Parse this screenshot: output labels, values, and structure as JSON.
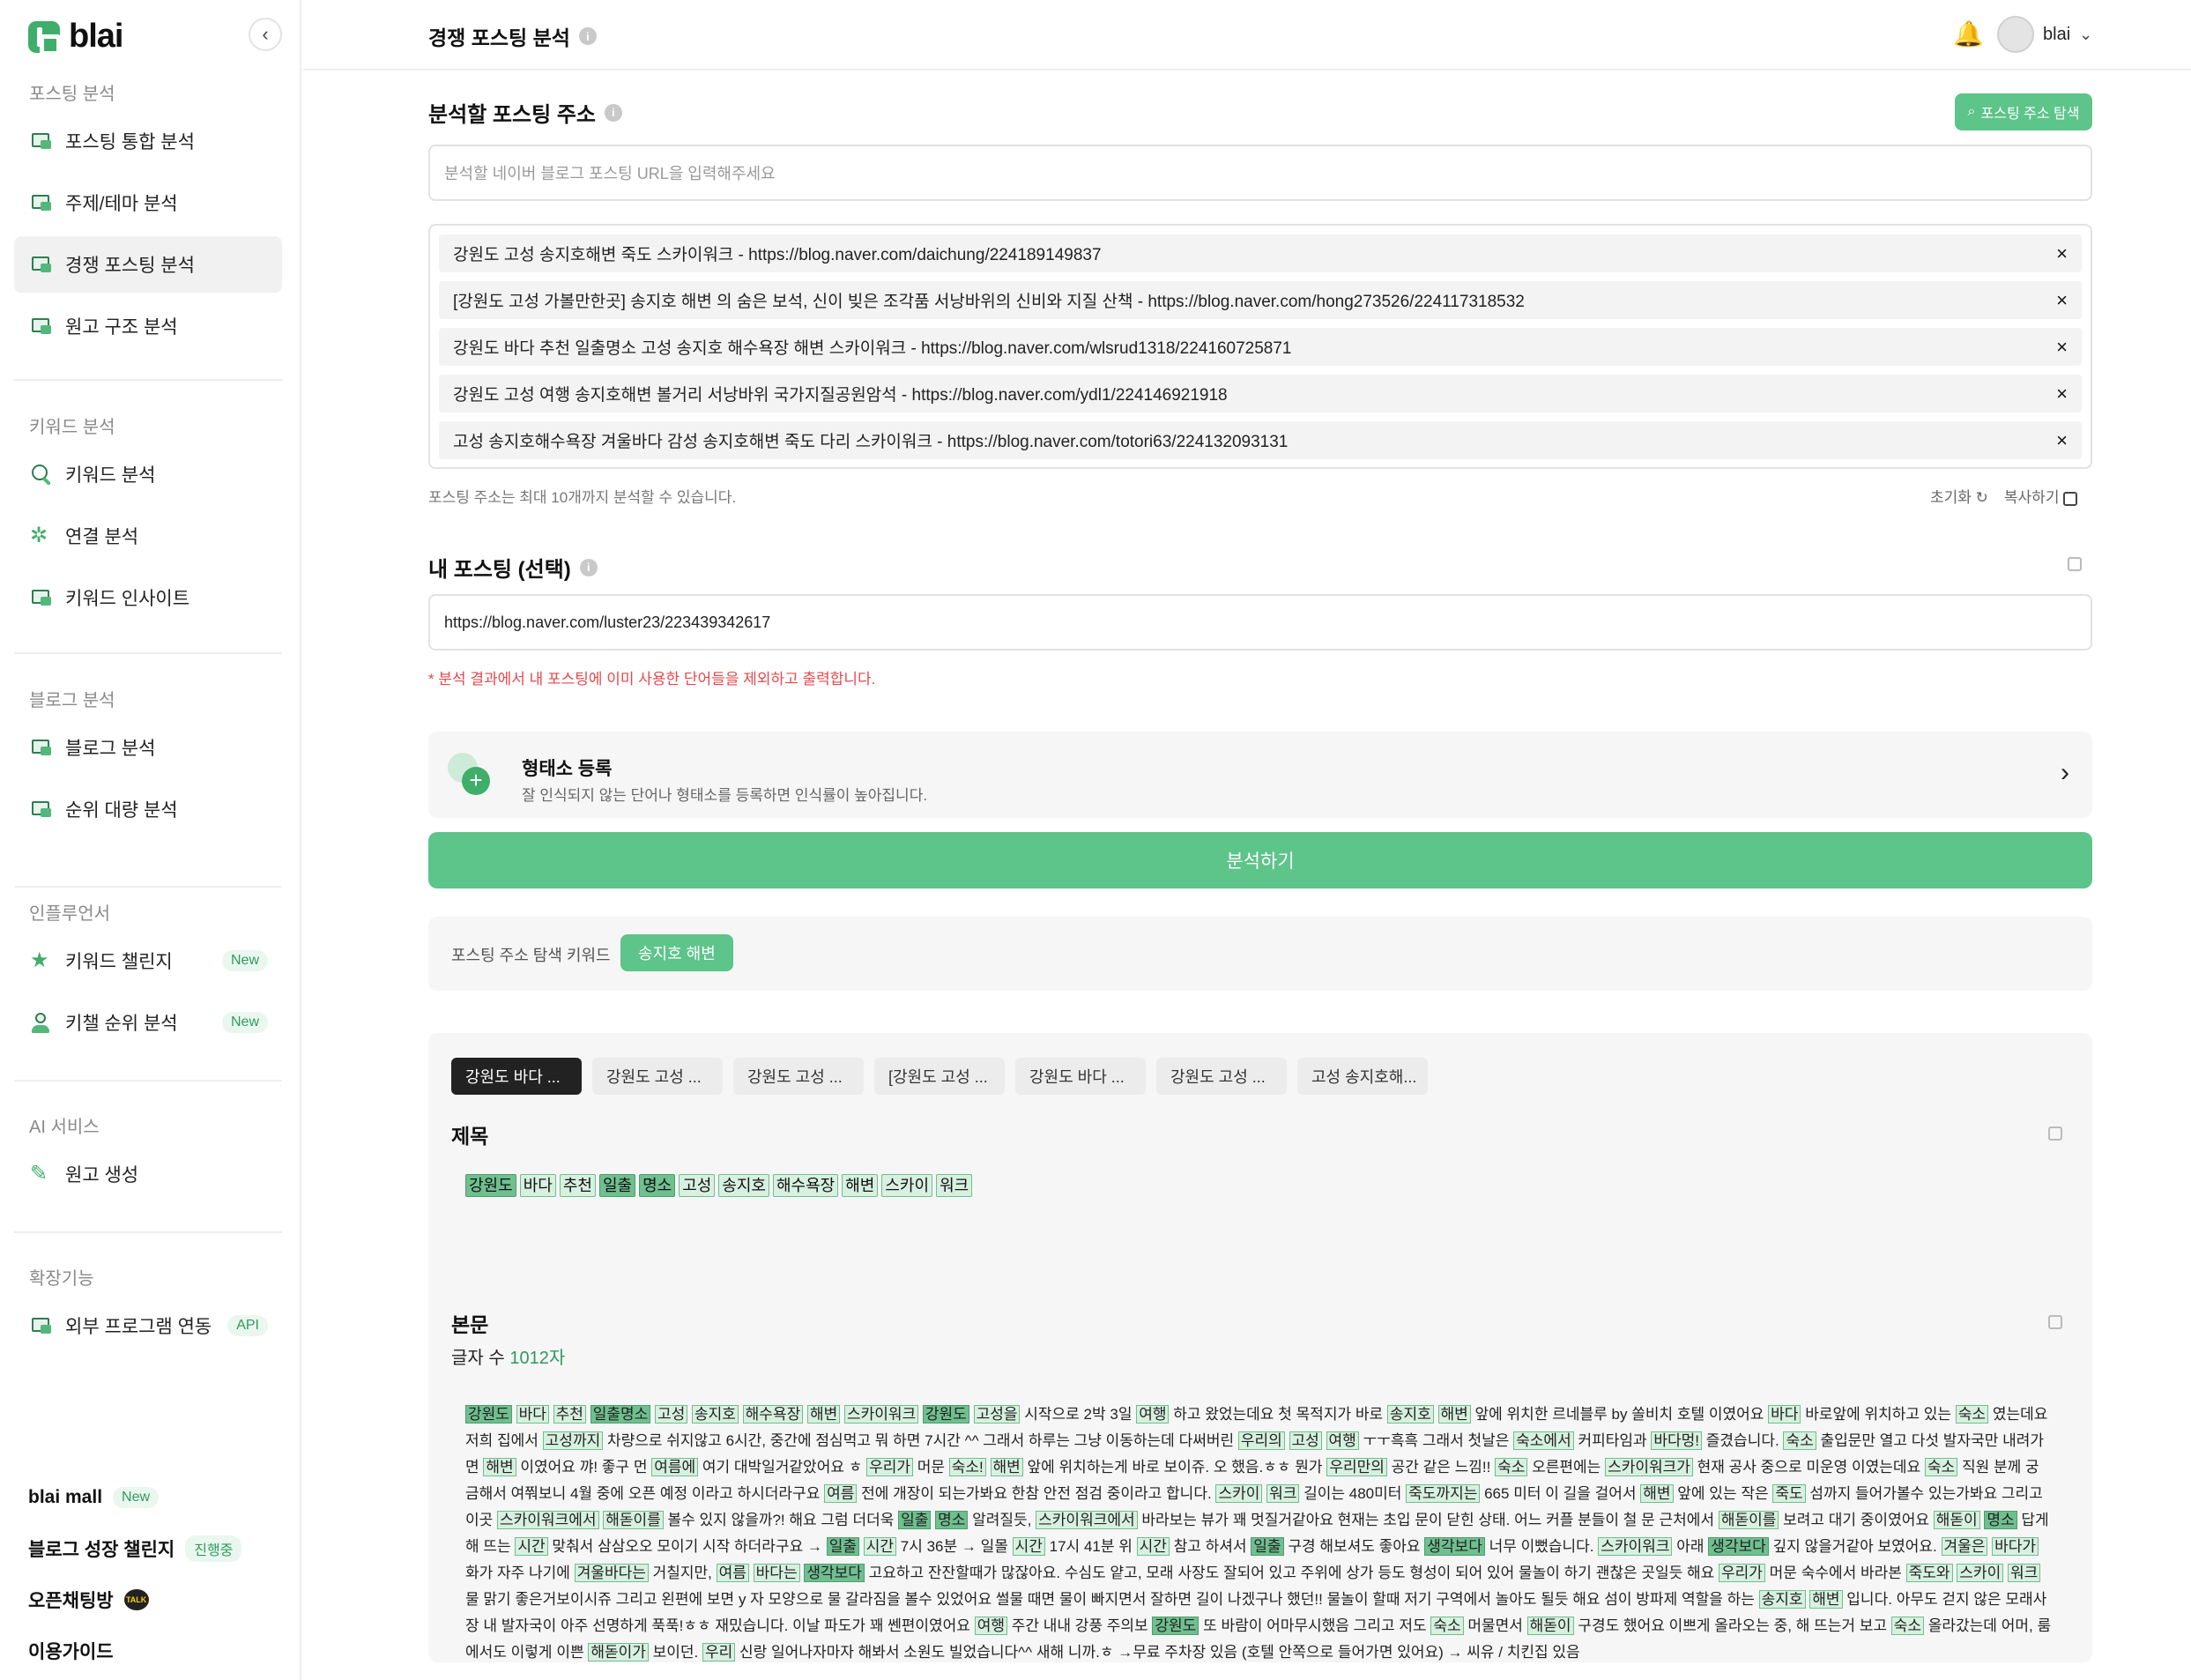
{
  "brand": {
    "name": "blai"
  },
  "sidebar": {
    "sections": [
      {
        "heading": "포스팅 분석",
        "items": [
          {
            "label": "포스팅 통합 분석"
          },
          {
            "label": "주제/테마 분석"
          },
          {
            "label": "경쟁 포스팅 분석"
          },
          {
            "label": "원고 구조 분석"
          }
        ]
      },
      {
        "heading": "키워드 분석",
        "items": [
          {
            "label": "키워드 분석"
          },
          {
            "label": "연결 분석"
          },
          {
            "label": "키워드 인사이트"
          }
        ]
      },
      {
        "heading": "블로그 분석",
        "items": [
          {
            "label": "블로그 분석"
          },
          {
            "label": "순위 대량 분석"
          }
        ]
      },
      {
        "heading": "인플루언서",
        "items": [
          {
            "label": "키워드 챌린지",
            "badge": "New"
          },
          {
            "label": "키챌 순위 분석",
            "badge": "New"
          }
        ]
      },
      {
        "heading": "AI 서비스",
        "items": [
          {
            "label": "원고 생성"
          }
        ]
      },
      {
        "heading": "확장기능",
        "items": [
          {
            "label": "외부 프로그램 연동",
            "badge": "API"
          }
        ]
      }
    ],
    "bottom": [
      {
        "label": "blai mall",
        "tag": "New"
      },
      {
        "label": "블로그 성장 챌린지",
        "tag": "진행중"
      },
      {
        "label": "오픈채팅방",
        "icon_text": "TALK"
      },
      {
        "label": "이용가이드"
      }
    ]
  },
  "header": {
    "title": "경쟁 포스팅 분석",
    "user": "blai"
  },
  "posting": {
    "title": "분석할 포스팅 주소",
    "explore_button": "포스팅 주소 탐색",
    "placeholder": "분석할 네이버 블로그 포스팅 URL을 입력해주세요",
    "urls": [
      "강원도 고성 송지호해변 죽도 스카이워크 - https://blog.naver.com/daichung/224189149837",
      "[강원도 고성 가볼만한곳] 송지호 해변 의 숨은 보석, 신이 빚은 조각품 서낭바위의 신비와 지질 산책 - https://blog.naver.com/hong273526/224117318532",
      "강원도 바다 추천 일출명소 고성 송지호 해수욕장 해변 스카이워크 - https://blog.naver.com/wlsrud1318/224160725871",
      "강원도 고성 여행 송지호해변 볼거리 서낭바위 국가지질공원암석 - https://blog.naver.com/ydl1/224146921918",
      "고성 송지호해수욕장 겨울바다 감성 송지호해변 죽도 다리 스카이워크 - https://blog.naver.com/totori63/224132093131"
    ],
    "limit_note": "포스팅 주소는 최대 10개까지 분석할 수 있습니다.",
    "reset": "초기화",
    "copy": "복사하기"
  },
  "my_posting": {
    "title": "내 포스팅 (선택)",
    "value": "https://blog.naver.com/luster23/223439342617",
    "warning": "* 분석 결과에서 내 포스팅에 이미 사용한 단어들을 제외하고 출력합니다."
  },
  "morph": {
    "icon_text": "가",
    "title": "형태소 등록",
    "subtitle": "잘 인식되지 않는 단어나 형태소를 등록하면 인식률이 높아집니다."
  },
  "analyze_button": "분석하기",
  "keyword_bar": {
    "label": "포스팅 주소 탐색 키워드",
    "chip": "송지호 해변"
  },
  "result": {
    "tabs": [
      "강원도 바다 ...",
      "강원도 고성 ...",
      "강원도 고성 ...",
      "[강원도 고성 ...",
      "강원도 바다 ...",
      "강원도 고성 ...",
      "고성 송지호해..."
    ],
    "title_heading": "제목",
    "title_tokens": [
      {
        "t": "강원도",
        "d": true
      },
      {
        "t": "바다"
      },
      {
        "t": "추천"
      },
      {
        "t": "일출",
        "d": true
      },
      {
        "t": "명소",
        "d": true
      },
      {
        "t": "고성"
      },
      {
        "t": "송지호"
      },
      {
        "t": "해수욕장"
      },
      {
        "t": "해변"
      },
      {
        "t": "스카이"
      },
      {
        "t": "워크"
      }
    ],
    "body_heading": "본문",
    "count_label": "글자 수",
    "count_value": "1012자",
    "body": "강원도 바다 추천 일출명소 고성 송지호 해수욕장 해변 스카이워크 강원도 고성을 시작으로 2박 3일 여행 하고 왔었는데요 첫 목적지가 바로 송지호 해변 앞에 위치한 르네블루 by 쏠비치 호텔 이였어요 바다 바로앞에 위치하고 있는 숙소 였는데요 저희 집에서 고성까지 차량으로 쉬지않고 6시간, 중간에 점심먹고 뭐 하면 7시간 ^^ 그래서 하루는 그냥 이동하는데 다써버린 우리의 고성 여행 ㅜㅜ흑흑 그래서 첫날은 숙소에서 커피타임과 바다멍! 즐겼습니다. 숙소 출입문만 열고 다섯 발자국만 내려가면 해변 이였어요 꺄! 좋구 먼 여름에 여기 대박일거같았어요 ㅎ 우리가 머문 숙소! 해변 앞에 위치하는게 바로 보이쥬. 오 했음.ㅎㅎ 뭔가 우리만의 공간 같은 느낌!! 숙소 오른편에는 스카이워크가 현재 공사 중으로 미운영 이였는데요 숙소 직원 분께 궁금해서 여쭤보니 4월 중에 오픈 예정 이라고 하시더라구요 여름 전에 개장이 되는가봐요 한참 안전 점검 중이라고 합니다. 스카이 워크 길이는 480미터 죽도까지는 665 미터 이 길을 걸어서 해변 앞에 있는 작은 죽도 섬까지 들어가볼수 있는가봐요 그리고 이곳 스카이워크에서 해돋이를 볼수 있지 않을까?! 해요 그럼 더더욱 일출 명소 알려질듯, 스카이워크에서 바라보는 뷰가 꽤 멋질거같아요 현재는 초입 문이 닫힌 상태. 어느 커플 분들이 철 문 근처에서 해돋이를 보려고 대기 중이였어요 해돋이 명소 답게 해 뜨는 시간 맞춰서 삼삼오오 모이기 시작 하더라구요 → 일출 시간 7시 36분 → 일몰 시간 17시 41분 위 시간 참고 하셔서 일출 구경 해보셔도 좋아요 생각보다 너무 이뻤습니다. 스카이워크 아래 생각보다 깊지 않을거같아 보였어요. 겨울은 바다가 화가 자주 나기에 겨울바다는 거칠지만, 여름 바다는 생각보다 고요하고 잔잔할때가 많잖아요. 수심도 얕고, 모래 사장도 잘되어 있고 주위에 상가 등도 형성이 되어 있어 물놀이 하기 괜찮은 곳일듯 해요 우리가 머문 숙수에서 바라본 죽도와 스카이 워크 물 맑기 좋은거보이시쥬 그리고 왼편에 보면 y 자 모양으로 물 갈라짐을 볼수 있었어요 썰물 때면 물이 빠지면서 잘하면 길이 나겠구나 했던!! 물놀이 할때 저기 구역에서 놀아도 될듯 해요 섬이 방파제 역할을 하는 송지호 해변 입니다. 아무도 걷지 않은 모래사장 내 발자국이 아주 선명하게 푹푹!ㅎㅎ 재밌습니다. 이날 파도가 꽤 쎈편이였어요 여행 주간 내내 강풍 주의보 강원도 또 바람이 어마무시했음 그리고 저도 숙소 머물면서 해돋이 구경도 했어요 이쁘게 올라오는 중, 해 뜨는거 보고 숙소 올라갔는데 어머, 룸에서도 이렇게 이쁜 해돋이가 보이던. 우리 신랑 일어나자마자 해봐서 소원도 빌었습니다^^ 새해 니까.ㅎ →무료 주차장 있음 (호텔 안쪽으로 들어가면 있어요) → 씨유 / 치킨집 있음"
  }
}
